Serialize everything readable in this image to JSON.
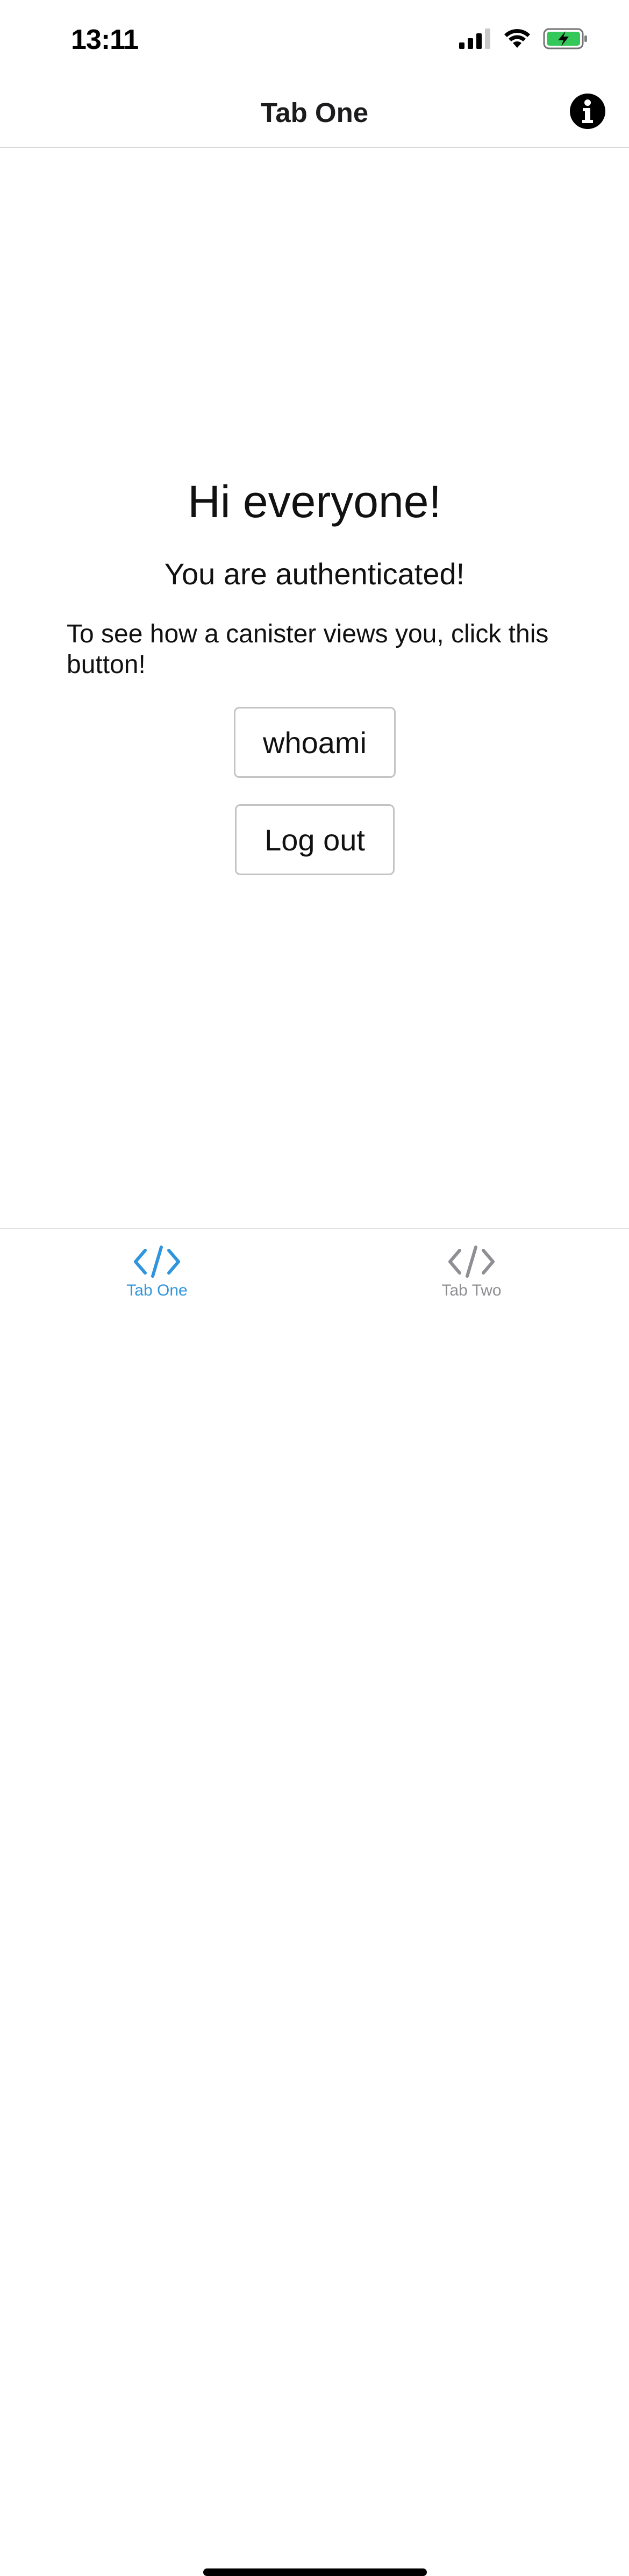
{
  "status_bar": {
    "time": "13:11",
    "icons": [
      "signal-icon",
      "wifi-icon",
      "battery-charging-icon"
    ],
    "battery_color": "#34c759"
  },
  "header": {
    "title": "Tab One",
    "info_icon": "info-icon"
  },
  "main": {
    "greeting": "Hi everyone!",
    "auth_status": "You are authenticated!",
    "instruction": "To see how a canister views you, click this button!",
    "whoami_label": "whoami",
    "logout_label": "Log out"
  },
  "tab_bar": {
    "active_color": "#2f95dc",
    "inactive_color": "#8e8e93",
    "tabs": [
      {
        "label": "Tab One",
        "icon": "code-icon",
        "active": true
      },
      {
        "label": "Tab Two",
        "icon": "code-icon",
        "active": false
      }
    ]
  }
}
